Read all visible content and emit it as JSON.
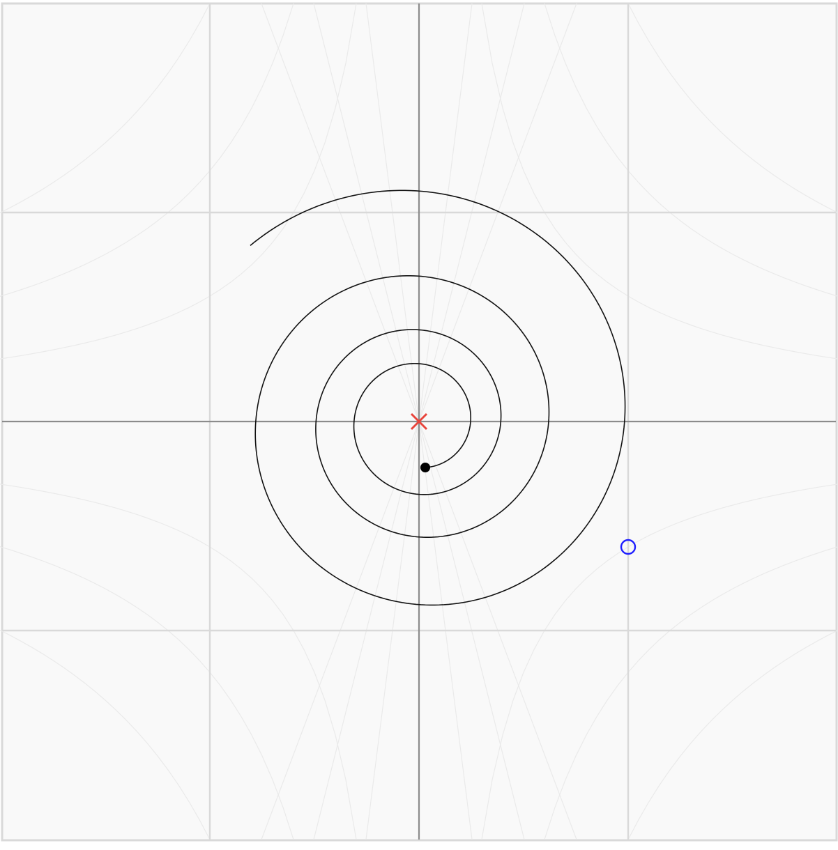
{
  "colors": {
    "background": "#f9f9f9",
    "frame": "#d9d9d9",
    "grid_major": "#d9d9d9",
    "grid_field": "#eaeaea",
    "axes": "#8c8c8c",
    "trajectory": "#111111",
    "start_marker": "#000000",
    "fixed_point_marker": "#e8453c",
    "end_marker": "#1d1dff"
  },
  "markers": {
    "fixed_point": {
      "shape": "x-cross",
      "x": 0,
      "y": 0
    },
    "trajectory_start": {
      "shape": "filled-dot",
      "x": 0.03,
      "y": -0.22
    },
    "trajectory_end": {
      "shape": "open-circle",
      "x": 1.0,
      "y": -0.6
    }
  },
  "trajectory": {
    "description_shape": "outward spiral",
    "turns": 3.6
  },
  "grid": {
    "major_lines": [
      -1,
      1
    ],
    "axes_at": 0,
    "range": [
      -2,
      2
    ]
  }
}
